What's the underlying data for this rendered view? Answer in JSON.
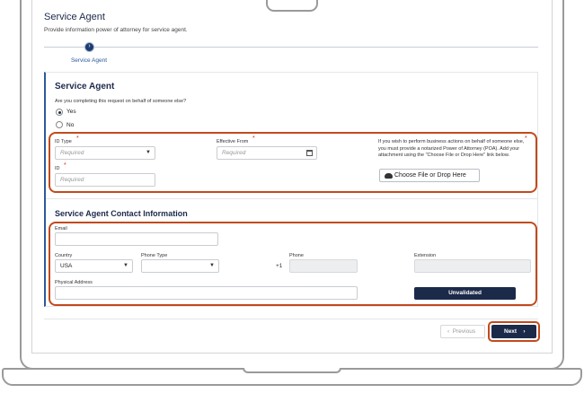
{
  "header": {
    "title": "Service Agent",
    "subtitle": "Provide information power of attorney for service agent."
  },
  "stepper": {
    "step_icon": "chevron-right-icon",
    "step_glyph": "›",
    "step_label": "Service Agent"
  },
  "service_agent": {
    "title": "Service Agent",
    "question": "Are you completing this request on behalf of someone else?",
    "options": [
      {
        "label": "Yes",
        "selected": true
      },
      {
        "label": "No",
        "selected": false
      }
    ],
    "id_type": {
      "label": "ID Type",
      "placeholder": "Required"
    },
    "effective_from": {
      "label": "Effective From",
      "placeholder": "Required"
    },
    "id": {
      "label": "ID",
      "placeholder": "Required"
    },
    "required_mark": "*",
    "poa_note": "If you wish to perform business actions on behalf of someone else, you must provide a notarized Power of Attorney (POA). Add your attachment using the \"Choose File or Drop Here\" link below.",
    "choose_file_label": "Choose File or Drop Here"
  },
  "contact": {
    "title": "Service Agent Contact Information",
    "email_label": "Email",
    "country_label": "Country",
    "country_value": "USA",
    "phone_type_label": "Phone Type",
    "country_code": "+1",
    "phone_label": "Phone",
    "extension_label": "Extension",
    "address_label": "Physical Address",
    "unvalidated_label": "Unvalidated"
  },
  "footer": {
    "previous_label": "Previous",
    "next_label": "Next",
    "prev_glyph": "‹",
    "next_glyph": "›"
  },
  "colors": {
    "primary": "#1c2a4a",
    "accent": "#2c5a9c",
    "highlight": "#c24a1c",
    "required": "#dd2222"
  }
}
